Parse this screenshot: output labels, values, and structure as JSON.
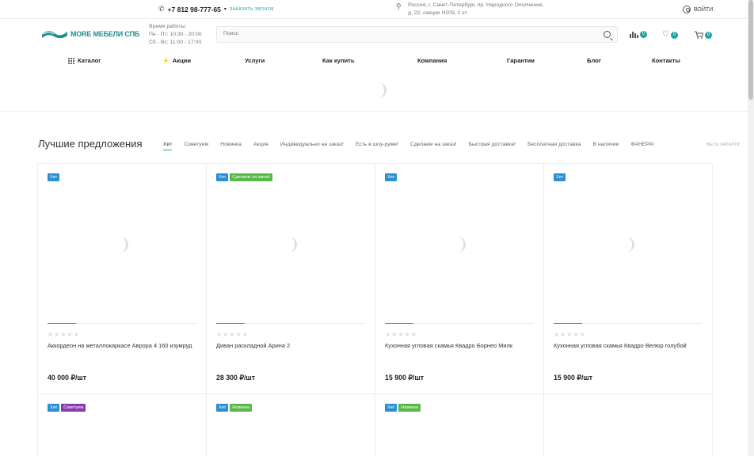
{
  "topbar": {
    "phone": "+7 812 98-777-65",
    "callback": "ЗАКАЗАТЬ ЗВОНОК",
    "address_line1": "Россия, г. Санкт-Петербург, пр. Народного Ополчения,",
    "address_line2": "д. 22, секция Н209, 2 эт.",
    "login": "ВОЙТИ"
  },
  "header": {
    "logo_text": "MORE МЕБЕЛИ СПБ",
    "hours_title": "Время работы:",
    "hours_weekdays": "Пн - Пт: 10:30 - 20:00",
    "hours_weekend": "Сб - Вс: 11:00 - 17:00",
    "search_placeholder": "Поиск",
    "compare_count": "0",
    "favorites_count": "0",
    "cart_count": "0"
  },
  "nav": {
    "catalog": "Каталог",
    "promo": "Акции",
    "services": "Услуги",
    "how_to_buy": "Как купить",
    "company": "Компания",
    "guarantees": "Гарантии",
    "blog": "Блог",
    "contacts": "Контакты"
  },
  "offers": {
    "title": "Лучшие предложения",
    "all_link": "ВЕСЬ КАТАЛОГ",
    "tabs": [
      "Хит",
      "Советуем",
      "Новинка",
      "Акция",
      "Индивидуально на заказ!",
      "Есть в шоу-руме!",
      "Сделаем на заказ!",
      "Быстрая доставка!",
      "Бесплатная доставка",
      "В наличии",
      "ФАНЕРА!"
    ],
    "products": [
      {
        "stickers": [
          "Хит"
        ],
        "name": "Аккордеон на металлокаркасе Аврора 4 160 изумруд",
        "price": "40 000 ₽/шт"
      },
      {
        "stickers": [
          "Хит",
          "Сделаем на заказ!"
        ],
        "name": "Диван раскладной Арина 2",
        "price": "28 300 ₽/шт"
      },
      {
        "stickers": [
          "Хит"
        ],
        "name": "Кухонная угловая скамья Квадро Борнео Милк",
        "price": "15 900 ₽/шт"
      },
      {
        "stickers": [
          "Хит"
        ],
        "name": "Кухонная угловая скамья Квадро Велюр голубой",
        "price": "15 900 ₽/шт"
      },
      {
        "stickers": [
          "Хит",
          "Советуем"
        ]
      },
      {
        "stickers": [
          "Хит",
          "Новинка"
        ]
      },
      {
        "stickers": [
          "Хит",
          "Новинка"
        ]
      }
    ]
  },
  "colors": {
    "accent": "#1fa3a0",
    "sticker_hit": "#2a8fd3",
    "sticker_green": "#57b947",
    "sticker_purple": "#8b3bb0"
  }
}
